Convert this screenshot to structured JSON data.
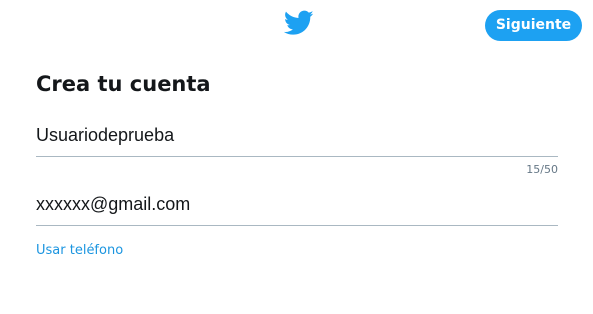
{
  "header": {
    "logo_icon": "twitter-bird-icon",
    "next_label": "Siguiente"
  },
  "form": {
    "title": "Crea tu cuenta",
    "name_value": "Usuariodeprueba",
    "name_counter": "15/50",
    "email_value": "xxxxxx@gmail.com",
    "use_phone_label": "Usar teléfono"
  },
  "colors": {
    "accent": "#1da1f2",
    "link": "#1b95e0",
    "divider": "#aab8c2",
    "text": "#14171a",
    "muted": "#657786"
  }
}
